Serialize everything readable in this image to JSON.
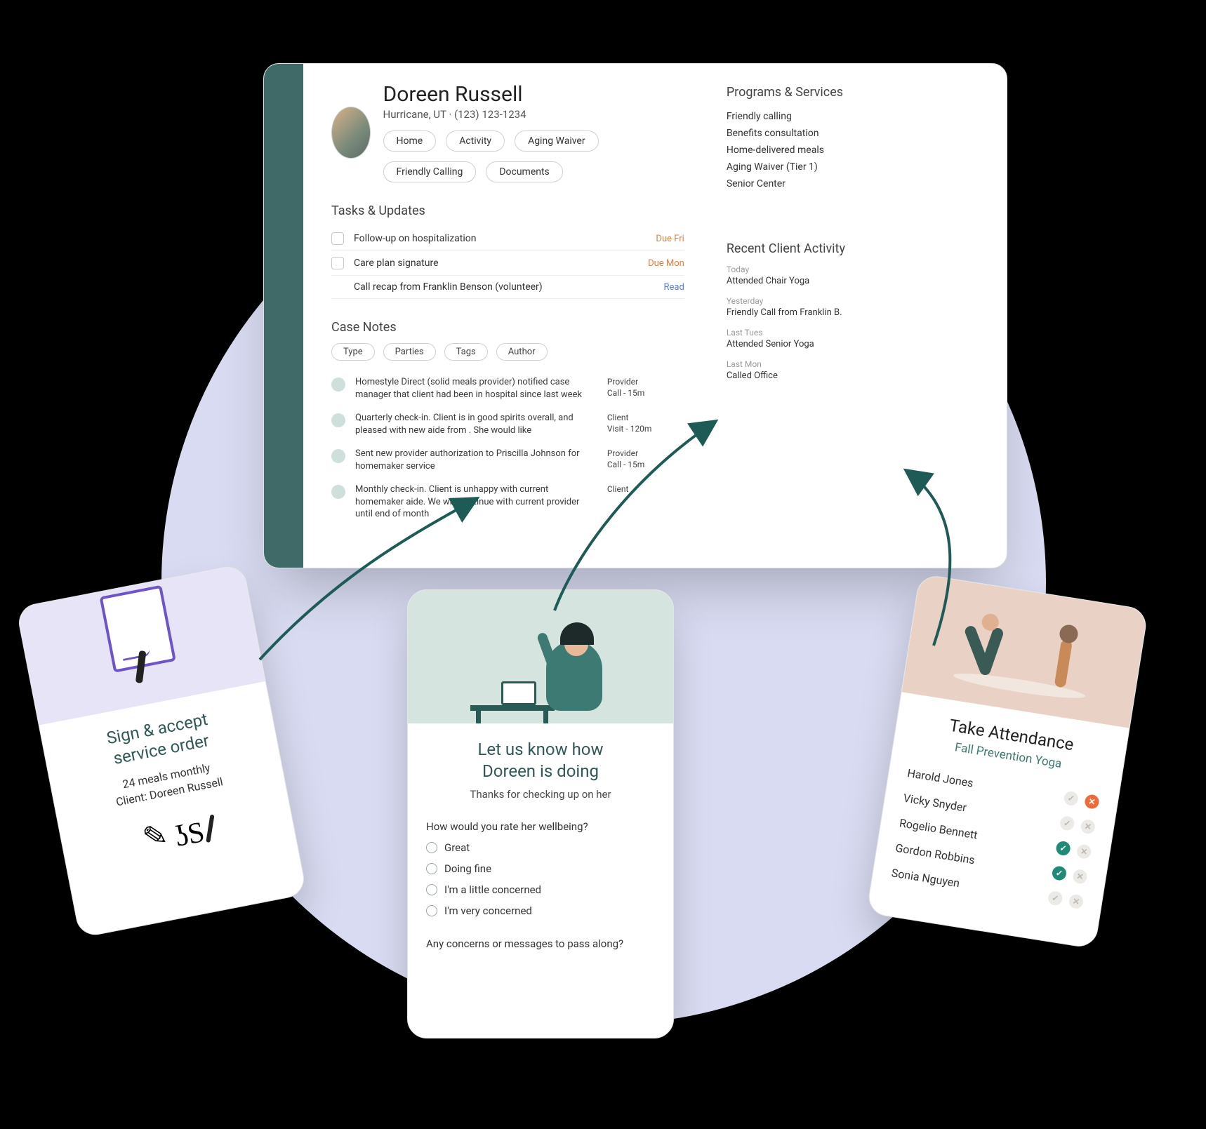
{
  "client": {
    "name": "Doreen Russell",
    "location": "Hurricane, UT · (123) 123-1234"
  },
  "tabs": [
    "Home",
    "Activity",
    "Aging Waiver",
    "Friendly Calling",
    "Documents"
  ],
  "tasks_heading": "Tasks & Updates",
  "tasks": [
    {
      "label": "Follow-up on hospitalization",
      "due": "Due Fri",
      "due_style": "orange",
      "checkbox": true
    },
    {
      "label": "Care plan signature",
      "due": "Due Mon",
      "due_style": "orange",
      "checkbox": true
    },
    {
      "label": "Call recap from Franklin Benson (volunteer)",
      "due": "Read",
      "due_style": "blue",
      "checkbox": false
    }
  ],
  "notes_heading": "Case Notes",
  "note_filters": [
    "Type",
    "Parties",
    "Tags",
    "Author"
  ],
  "notes": [
    {
      "text": "Homestyle Direct (solid meals provider) notified case manager that client had been in hospital since last week",
      "meta1": "Provider",
      "meta2": "Call - 15m"
    },
    {
      "text": "Quarterly check-in. Client is in good spirits overall, and pleased with new aide from . She would like",
      "meta1": "Client",
      "meta2": "Visit - 120m"
    },
    {
      "text": "Sent new provider authorization to Priscilla Johnson for homemaker service",
      "meta1": "Provider",
      "meta2": "Call - 15m"
    },
    {
      "text": "Monthly check-in. Client is unhappy with current homemaker aide. We will continue with current provider until end of month",
      "meta1": "Client",
      "meta2": ""
    }
  ],
  "programs_heading": "Programs & Services",
  "programs": [
    "Friendly calling",
    "Benefits consultation",
    "Home-delivered meals",
    "Aging Waiver (Tier 1)",
    "Senior Center"
  ],
  "recent_heading": "Recent Client Activity",
  "recent": [
    {
      "when": "Today",
      "what": "Attended Chair Yoga"
    },
    {
      "when": "Yesterday",
      "what": "Friendly Call from Franklin B."
    },
    {
      "when": "Last Tues",
      "what": "Attended Senior Yoga"
    },
    {
      "when": "Last Mon",
      "what": "Called Office"
    }
  ],
  "sign_card": {
    "title_l1": "Sign & accept",
    "title_l2": "service order",
    "line1": "24 meals monthly",
    "line2": "Client: Doreen Russell"
  },
  "feedback_card": {
    "title_l1": "Let us know how",
    "title_l2": "Doreen is doing",
    "subtitle": "Thanks for checking up on her",
    "question": "How would you rate her wellbeing?",
    "options": [
      "Great",
      "Doing fine",
      "I'm a little concerned",
      "I'm very concerned"
    ],
    "question2": "Any concerns or messages to pass along?"
  },
  "attendance_card": {
    "title": "Take Attendance",
    "subtitle": "Fall Prevention Yoga",
    "rows": [
      {
        "name": "Harold Jones",
        "check": "off",
        "x": "on"
      },
      {
        "name": "Vicky Snyder",
        "check": "off",
        "x": "off"
      },
      {
        "name": "Rogelio Bennett",
        "check": "on",
        "x": "off"
      },
      {
        "name": "Gordon Robbins",
        "check": "on",
        "x": "off"
      },
      {
        "name": "Sonia Nguyen",
        "check": "off",
        "x": "off"
      }
    ]
  }
}
